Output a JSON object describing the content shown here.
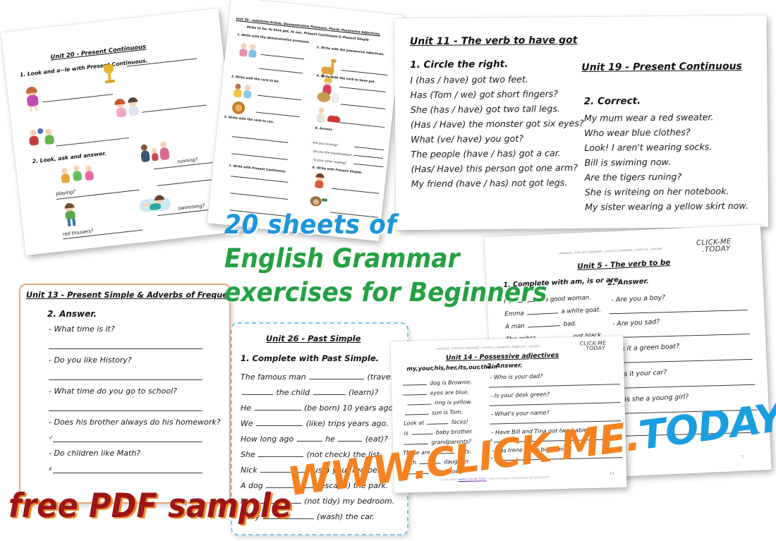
{
  "promo": {
    "line1": "20  sheets of",
    "line2": "English Grammar",
    "line3": "exercises for Beginners",
    "free_sample": "free PDF sample",
    "watermark_orange": "WWW.CLICK-ME.",
    "watermark_blue": "TODAY",
    "color_blue": "#1b96dc",
    "color_green": "#24a142",
    "color_darkred": "#9c1616",
    "color_orange": "#f58220"
  },
  "brand": {
    "logo_line1": "CLICK-ME",
    "logo_line2": ".TODAY",
    "breadcrumb": "LANGUAGE | ENGLISH | BEGINNER | JUNIOR A | GRAMMAR | COMPLETE - ANSWER",
    "footer_prefix": "© COPYRIGHT",
    "footer_link1": "WWW.",
    "footer_link2": "CLICK-ME.TODAY",
    "footer_suffix": "- FREE PRINTABLE WORKSHEETS FOR BEGINNERS",
    "page_number": "14",
    "page_number_5": "5"
  },
  "unit20": {
    "title": "Unit 20 - Present Continuous",
    "task1": "1.  Look and a~le with Present Continuous.",
    "task2": "2. Look, ask and answer.",
    "labels": [
      "playing?",
      "running?",
      "red trousers?",
      "swimming?"
    ]
  },
  "unit30": {
    "title": "Unit 30 - Indefinite Article, Demonstrative Pronouns, Plural,  Possessive Adjectives,",
    "title2": "Verbs to be, to have got, to can,  Present Continuous & Present Simple",
    "task1": "1. Write with the demonstrative pronouns.",
    "task2": "2. Write with the possessive adjectives.",
    "task3": "3. Write with the verb to be.",
    "task4": "4. Write with the verb to have got.",
    "task5": "5. Write with the verb to can.",
    "task6": "6. Answer.",
    "task7": "7. Write with Present Continuous.",
    "task8": "8. Write with Present Simple.",
    "questions": [
      "- Are you running?",
      "- Do you like marshmallow?",
      "- Is your sister reading?"
    ]
  },
  "unit11": {
    "title": "Unit 11 - The verb to have got",
    "task": "1. Circle the right.",
    "lines": [
      "I (has / have) got two feet.",
      "Has (Tom / we) got short fingers?",
      "She (has / have) got two tall legs.",
      "(Has / Have) the monster got six eyes?",
      "What (ve/ have)  you got?",
      "The people  (have / has)  got a car.",
      "(Has/ Have) this person got one arm?",
      "My friend (have / has) not got legs."
    ]
  },
  "unit19": {
    "title": "Unit 19 - Present Continuous",
    "task": "2.  Correct.",
    "lines": [
      "My mum wear a red sweater.",
      "Who wear blue clothes?",
      "Look! I aren't wearing socks.",
      "Bill is swiming  now.",
      "Are the tigers runing?",
      "She is writeing on her notebook.",
      "My sister wearing a yellow skirt now."
    ]
  },
  "unit13": {
    "title": "Unit 13 - Present Simple & Adverbs of Frequency",
    "task": "2. Answer.",
    "questions": [
      "- What time is it?",
      "- Do you like History?",
      "- What time do you go to school?",
      "- Does his brother always do his homework?",
      "- Do children like Math?"
    ],
    "mark_check": "✓",
    "mark_cross": "x"
  },
  "unit26": {
    "title": "Unit 26 - Past Simple",
    "task": "1. Complete with Past Simple.",
    "rows": [
      {
        "pre": "The famous man",
        "post": "(travel)."
      },
      {
        "pre": "",
        "mid": "the child",
        "post": "(learn)?"
      },
      {
        "pre": "He",
        "post": "(be born) 10  years ago."
      },
      {
        "pre": "We",
        "post": "(like) trips years ago."
      },
      {
        "pre": "How long ago",
        "mid": "he",
        "post": "(eat)?"
      },
      {
        "pre": "She",
        "post": "(not check) the list."
      },
      {
        "pre": "Nick",
        "post": "(use) your red pen."
      },
      {
        "pre": "A dog",
        "post": "(escape) the park."
      },
      {
        "pre": "I",
        "post": "(not tidy) my bedroom."
      },
      {
        "pre": "Mary",
        "post": "(wash) the car."
      }
    ]
  },
  "unit5": {
    "title": "Unit 5 - The verb to be",
    "task1": "1. Complete with am, is or are.",
    "task2": "2. Answer.",
    "left_rows": [
      {
        "pre": "I",
        "post": "a good woman."
      },
      {
        "pre": "Emma",
        "post": "a white goat."
      },
      {
        "pre": "A man",
        "post": "bad."
      },
      {
        "pre": "The zebra",
        "post": "not black."
      }
    ],
    "questions": [
      "- Are you a boy?",
      "- Are you sad?",
      "- Is it a green boat?",
      "- Is it your car?",
      "- Is she a young girl?"
    ]
  },
  "unit14": {
    "title": "Unit 14 - Possessive adjectives",
    "word_bank": "my,your,his,her,its,our,their.",
    "task2": "2. Answer.",
    "left_rows": [
      {
        "pre": "",
        "post": "dog is Brownie."
      },
      {
        "pre": "",
        "post": "eyes are blue."
      },
      {
        "pre": "",
        "post": "ring is yellow."
      },
      {
        "pre": "",
        "post": "son is Tom."
      },
      {
        "pre": "Look at",
        "post": "faces!"
      },
      {
        "pre": "is",
        "post": "baby brother."
      },
      {
        "pre": "",
        "post": "grandparents?"
      },
      {
        "pre": "These are",
        "post": "hats."
      },
      {
        "pre": "with",
        "post": "daughter."
      },
      {
        "pre": "",
        "post": "hair is long!"
      }
    ],
    "questions": [
      "- Who is your dad?",
      "- Is your desk green?",
      "- What's your name?",
      "- Have Bill and Tina got two babies?",
      "- Has Irene got a big family?"
    ],
    "mark_cross": "x",
    "mark_check": "✓"
  }
}
